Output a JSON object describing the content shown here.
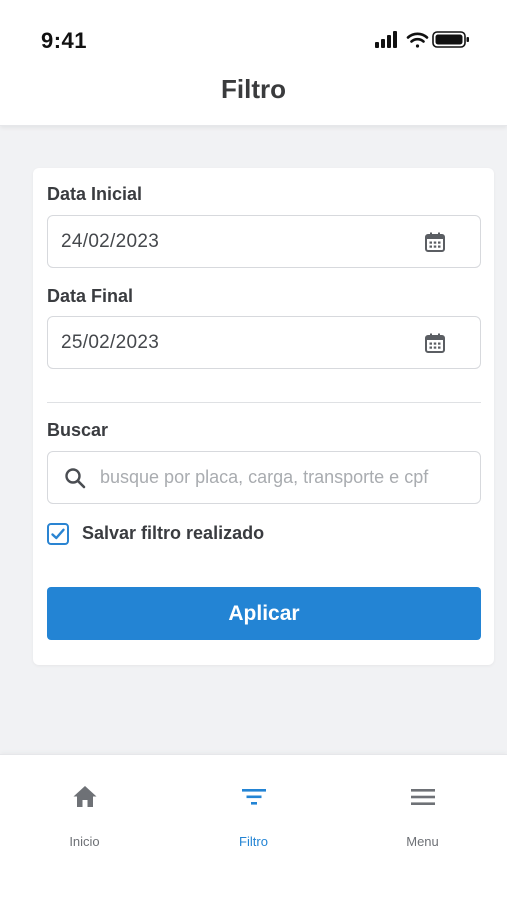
{
  "status_bar": {
    "time": "9:41"
  },
  "header": {
    "title": "Filtro"
  },
  "form": {
    "start_date": {
      "label": "Data Inicial",
      "value": "24/02/2023",
      "icon": "calendar-icon"
    },
    "end_date": {
      "label": "Data Final",
      "value": "25/02/2023",
      "icon": "calendar-icon"
    },
    "search": {
      "label": "Buscar",
      "placeholder": "busque por placa, carga, transporte e cpf",
      "value": "",
      "icon": "search-icon"
    },
    "save_filter": {
      "label": "Salvar filtro realizado",
      "checked": true
    },
    "apply_label": "Aplicar"
  },
  "bottom_nav": {
    "items": [
      {
        "label": "Inicio",
        "icon": "home-icon",
        "active": false
      },
      {
        "label": "Filtro",
        "icon": "filter-icon",
        "active": true
      },
      {
        "label": "Menu",
        "icon": "menu-icon",
        "active": false
      }
    ]
  },
  "colors": {
    "accent": "#2384d4",
    "background": "#f1f2f4",
    "icon_gray": "#6e7176"
  }
}
